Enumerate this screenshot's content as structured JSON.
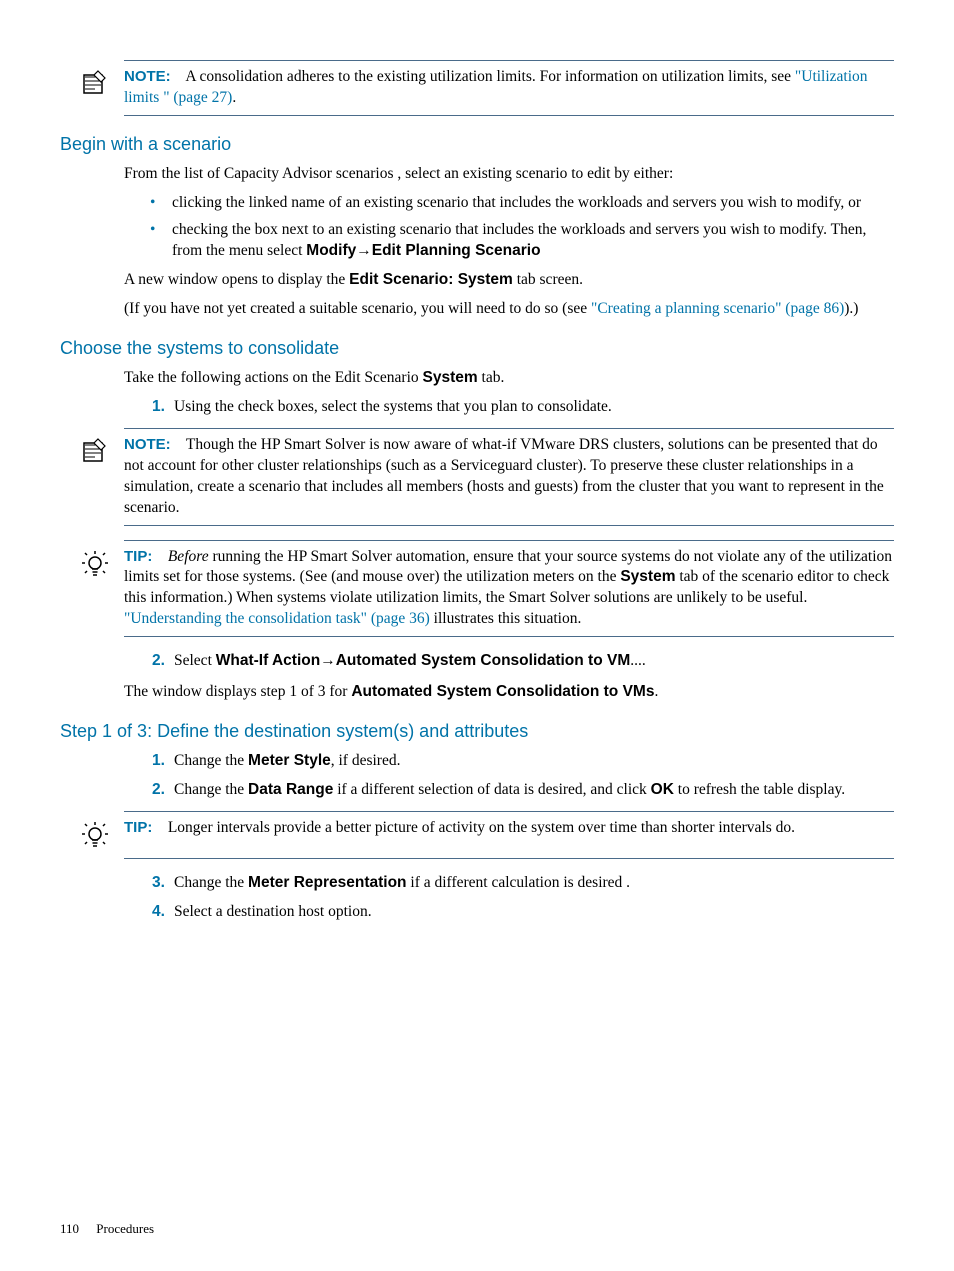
{
  "note1": {
    "lead": "NOTE:",
    "text_a": "A consolidation adheres to the existing utilization limits. For information on utilization limits, see ",
    "link": "\"Utilization limits \" (page 27)",
    "text_b": "."
  },
  "sec1": {
    "title": "Begin with a scenario",
    "intro": "From the list of Capacity Advisor scenarios , select an existing scenario to edit by either:",
    "b1": "clicking the linked name of an existing scenario that includes the workloads and servers you wish to modify, or",
    "b2a": "checking the box next to an existing scenario that includes the workloads and servers you wish to modify. Then, from the menu select ",
    "b2b": "Modify",
    "b2c": "Edit Planning Scenario",
    "p2a": "A new window opens to display the ",
    "p2b": "Edit Scenario: System",
    "p2c": " tab screen.",
    "p3a": "(If you have not yet created a suitable scenario, you will need to do so (see ",
    "p3link": "\"Creating a planning scenario\" (page 86)",
    "p3b": ").)"
  },
  "sec2": {
    "title": "Choose the systems to consolidate",
    "introA": "Take the following actions on the Edit Scenario ",
    "introB": "System",
    "introC": " tab.",
    "li1_num": "1.",
    "li1": "Using the check boxes, select the systems that you plan to consolidate."
  },
  "note2": {
    "lead": "NOTE:",
    "text": "Though the HP Smart Solver is now aware of what-if VMware DRS clusters, solutions can be presented that do not account for other cluster relationships (such as a Serviceguard cluster). To preserve these cluster relationships in a simulation, create a scenario that includes all members (hosts and guests) from the cluster that you want to represent in the scenario."
  },
  "tip1": {
    "lead": "TIP:",
    "before": "Before",
    "text_a": " running the HP Smart Solver automation, ensure that your source systems do not violate any of the utilization limits set for those systems. (See (and mouse over) the utilization meters on the ",
    "sys": "System",
    "text_b": " tab of the scenario editor to check this information.) When systems violate utilization limits, the Smart Solver solutions are unlikely to be useful. ",
    "link": "\"Understanding the consolidation task\" (page 36)",
    "text_c": " illustrates this situation."
  },
  "sec2b": {
    "li2_num": "2.",
    "li2a": "Select ",
    "li2b": "What-If Action",
    "li2c": "Automated System Consolidation to VM",
    "li2d": "....",
    "p_a": "The window displays step 1 of 3 for ",
    "p_b": "Automated System Consolidation to VMs",
    "p_c": "."
  },
  "sec3": {
    "title": "Step 1 of 3: Define the destination system(s) and attributes",
    "li1_num": "1.",
    "li1a": "Change the ",
    "li1b": "Meter Style",
    "li1c": ", if desired.",
    "li2_num": "2.",
    "li2a": "Change the ",
    "li2b": "Data Range",
    "li2c": " if a different selection of data is desired, and click ",
    "li2d": "OK",
    "li2e": " to refresh the table display."
  },
  "tip2": {
    "lead": "TIP:",
    "text": "Longer intervals provide a better picture of activity on the system over time than shorter intervals do."
  },
  "sec3b": {
    "li3_num": "3.",
    "li3a": "Change the ",
    "li3b": "Meter Representation",
    "li3c": " if a different calculation is desired .",
    "li4_num": "4.",
    "li4": "Select a destination host option."
  },
  "footer": {
    "page": "110",
    "label": "Procedures"
  }
}
